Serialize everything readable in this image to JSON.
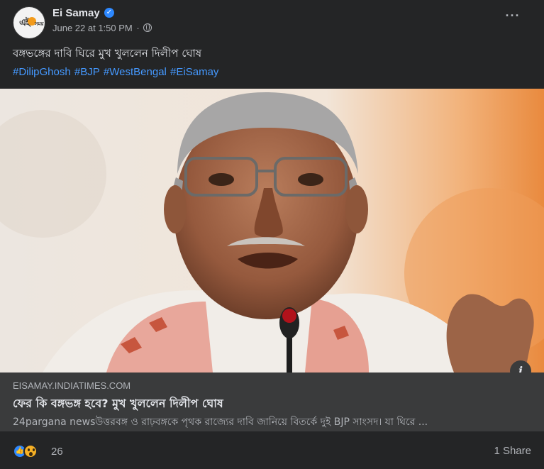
{
  "post": {
    "page_name": "Ei Samay",
    "timestamp": "June 22 at 1:50 PM",
    "separator": "·",
    "audience_icon": "globe-icon",
    "more_icon": "more-horizontal-icon",
    "text": "বঙ্গভঙ্গের দাবি ঘিরে মুখ খুললেন দিলীপ ঘোষ",
    "hashtags": [
      "#DilipGhosh",
      "#BJP",
      "#WestBengal",
      "#EiSamay"
    ]
  },
  "avatar": {
    "logo_text": "এই",
    "logo_tag": "সময়"
  },
  "link_preview": {
    "domain": "EISAMAY.INDIATIMES.COM",
    "title": "ফের কি বঙ্গভঙ্গ হবে? মুখ খুললেন দিলীপ ঘোষ",
    "description": "24pargana newsউত্তরবঙ্গ ও রাঢ়বঙ্গকে পৃথক রাজ্যের দাবি জানিয়ে বিতর্কে দুই BJP সাংসদ। যা ঘিরে ...",
    "info_icon": "info-icon"
  },
  "footer": {
    "reaction_icons": [
      "like-reaction-icon",
      "wow-reaction-icon"
    ],
    "reaction_count": "26",
    "shares": "1 Share"
  },
  "colors": {
    "background": "#242526",
    "link_box": "#3a3b3c",
    "hashtag": "#4599ff",
    "verified": "#2d88ff"
  }
}
